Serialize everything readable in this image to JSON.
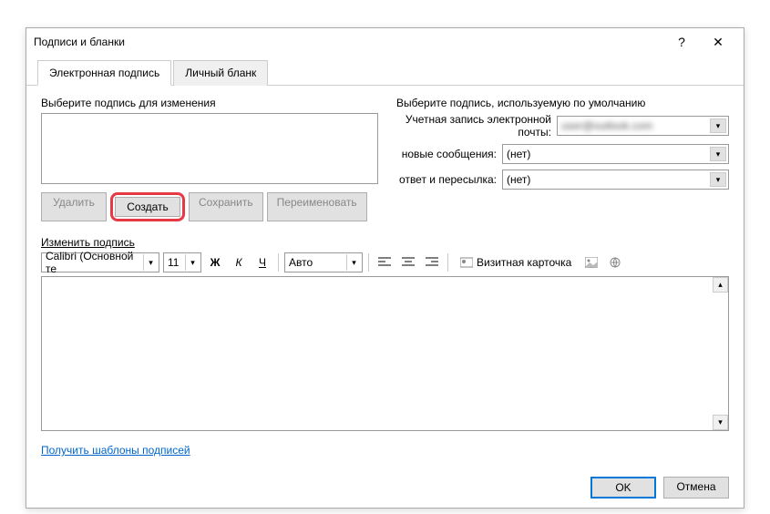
{
  "titlebar": {
    "title": "Подписи и бланки",
    "help": "?",
    "close": "✕"
  },
  "tabs": {
    "esig": "Электронная подпись",
    "stationery": "Личный бланк"
  },
  "left": {
    "label": "Выберите подпись для изменения",
    "btns": {
      "delete": "Удалить",
      "create": "Создать",
      "save": "Сохранить",
      "rename": "Переименовать"
    }
  },
  "right": {
    "label": "Выберите подпись, используемую по умолчанию",
    "account_label": "Учетная запись электронной почты:",
    "account_value": "user@outlook.com",
    "newmsg_label": "новые сообщения:",
    "newmsg_value": "(нет)",
    "reply_label": "ответ и пересылка:",
    "reply_value": "(нет)"
  },
  "edit": {
    "label": "Изменить подпись",
    "font": "Calibri (Основной те",
    "size": "11",
    "bold": "Ж",
    "italic": "К",
    "underline": "Ч",
    "color": "Авто",
    "bizcard": "Визитная карточка"
  },
  "link": "Получить шаблоны подписей",
  "footer": {
    "ok": "OK",
    "cancel": "Отмена"
  }
}
